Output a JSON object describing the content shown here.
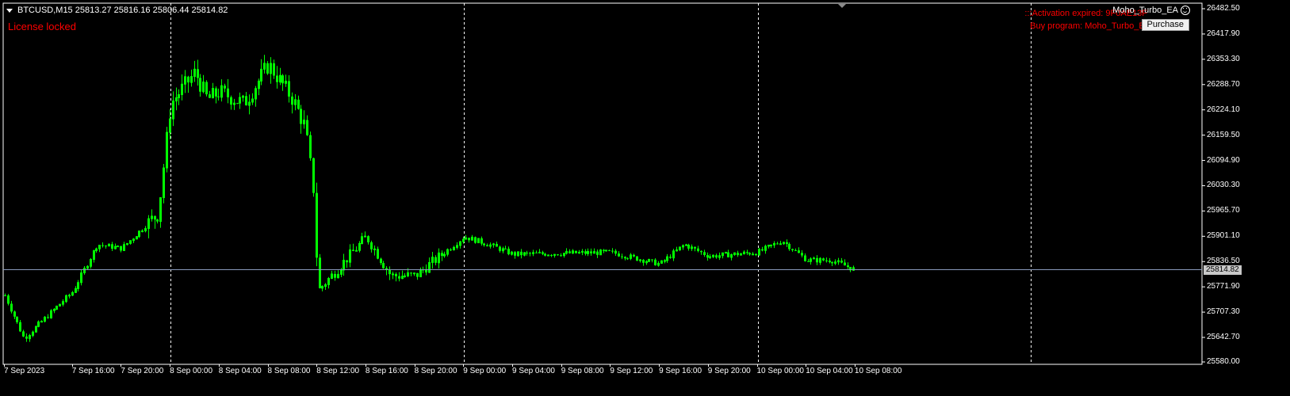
{
  "chart": {
    "symbol_header": "BTCUSD,M15  25813.27 25816.16 25806.44 25814.82",
    "license_text": "License locked",
    "activation_text": ":::Activation expired: 9F0AE13F",
    "buy_program_text": "Buy program: Moho_Turbo_EA",
    "ea_name": "Moho_Turbo_EA",
    "purchase_label": "Purchase",
    "current_price": "25814.82",
    "price_labels": [
      "26482.50",
      "26417.90",
      "26353.30",
      "26288.70",
      "26224.10",
      "26159.50",
      "26094.90",
      "26030.30",
      "25965.70",
      "25901.10",
      "25836.50",
      "25771.90",
      "25707.30",
      "25642.70",
      "25580.00"
    ],
    "time_labels": [
      "7 Sep 2023",
      "7 Sep 16:00",
      "7 Sep 20:00",
      "8 Sep 00:00",
      "8 Sep 04:00",
      "8 Sep 08:00",
      "8 Sep 12:00",
      "8 Sep 16:00",
      "8 Sep 20:00",
      "9 Sep 00:00",
      "9 Sep 04:00",
      "9 Sep 08:00",
      "9 Sep 12:00",
      "9 Sep 16:00",
      "9 Sep 20:00",
      "10 Sep 00:00",
      "10 Sep 04:00",
      "10 Sep 08:00"
    ],
    "colors": {
      "background": "#000000",
      "candle": "#00ff00",
      "grid": "#ffffff",
      "alert": "#ff0000",
      "price_line": "#8899bb"
    }
  },
  "chart_data": {
    "type": "candlestick",
    "symbol": "BTCUSD",
    "timeframe": "M15",
    "ylim": [
      25580.0,
      26482.5
    ],
    "x_ticks": [
      "7 Sep 2023",
      "7 Sep 16:00",
      "7 Sep 20:00",
      "8 Sep 00:00",
      "8 Sep 04:00",
      "8 Sep 08:00",
      "8 Sep 12:00",
      "8 Sep 16:00",
      "8 Sep 20:00",
      "9 Sep 00:00",
      "9 Sep 04:00",
      "9 Sep 08:00",
      "9 Sep 12:00",
      "9 Sep 16:00",
      "9 Sep 20:00",
      "10 Sep 00:00",
      "10 Sep 04:00",
      "10 Sep 08:00"
    ],
    "close_anchors": [
      {
        "t": "7 Sep 2023",
        "v": 25750
      },
      {
        "t": "7 Sep 12:00",
        "v": 25640
      },
      {
        "t": "7 Sep 16:00",
        "v": 25760
      },
      {
        "t": "7 Sep 18:00",
        "v": 25880
      },
      {
        "t": "7 Sep 20:00",
        "v": 25870
      },
      {
        "t": "7 Sep 23:00",
        "v": 25960
      },
      {
        "t": "8 Sep 00:00",
        "v": 26240
      },
      {
        "t": "8 Sep 02:00",
        "v": 26320
      },
      {
        "t": "8 Sep 03:00",
        "v": 26250
      },
      {
        "t": "8 Sep 04:00",
        "v": 26270
      },
      {
        "t": "8 Sep 06:00",
        "v": 26240
      },
      {
        "t": "8 Sep 08:00",
        "v": 26340
      },
      {
        "t": "8 Sep 10:00",
        "v": 26250
      },
      {
        "t": "8 Sep 11:00",
        "v": 26180
      },
      {
        "t": "8 Sep 11:45",
        "v": 26000
      },
      {
        "t": "8 Sep 12:00",
        "v": 25760
      },
      {
        "t": "8 Sep 14:00",
        "v": 25830
      },
      {
        "t": "8 Sep 16:00",
        "v": 25900
      },
      {
        "t": "8 Sep 18:00",
        "v": 25800
      },
      {
        "t": "8 Sep 20:00",
        "v": 25800
      },
      {
        "t": "9 Sep 00:00",
        "v": 25900
      },
      {
        "t": "9 Sep 02:00",
        "v": 25880
      },
      {
        "t": "9 Sep 04:00",
        "v": 25855
      },
      {
        "t": "9 Sep 12:00",
        "v": 25860
      },
      {
        "t": "9 Sep 16:00",
        "v": 25830
      },
      {
        "t": "9 Sep 18:00",
        "v": 25880
      },
      {
        "t": "9 Sep 20:00",
        "v": 25850
      },
      {
        "t": "10 Sep 00:00",
        "v": 25860
      },
      {
        "t": "10 Sep 02:00",
        "v": 25890
      },
      {
        "t": "10 Sep 04:00",
        "v": 25840
      },
      {
        "t": "10 Sep 06:00",
        "v": 25840
      },
      {
        "t": "10 Sep 08:00",
        "v": 25815
      }
    ],
    "grid": "vertical dashed separators"
  }
}
